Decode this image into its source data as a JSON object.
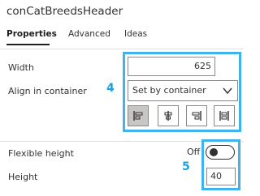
{
  "header": {
    "title": "conCatBreedsHeader"
  },
  "tabs": [
    {
      "label": "Properties",
      "active": true
    },
    {
      "label": "Advanced",
      "active": false
    },
    {
      "label": "Ideas",
      "active": false
    }
  ],
  "properties": {
    "width": {
      "label": "Width",
      "value": "625"
    },
    "align": {
      "label": "Align in container",
      "selected": "Set by container",
      "buttons": [
        "align-left-icon",
        "align-center-icon",
        "align-right-icon",
        "align-stretch-icon"
      ]
    },
    "flexible_height": {
      "label": "Flexible height",
      "state": "Off"
    },
    "height": {
      "label": "Height",
      "value": "40"
    }
  },
  "callouts": {
    "first": "4",
    "second": "5"
  },
  "colors": {
    "highlight": "#3fb4ec",
    "callout": "#1e9fe0",
    "selected_button": "#c8c6c4"
  }
}
